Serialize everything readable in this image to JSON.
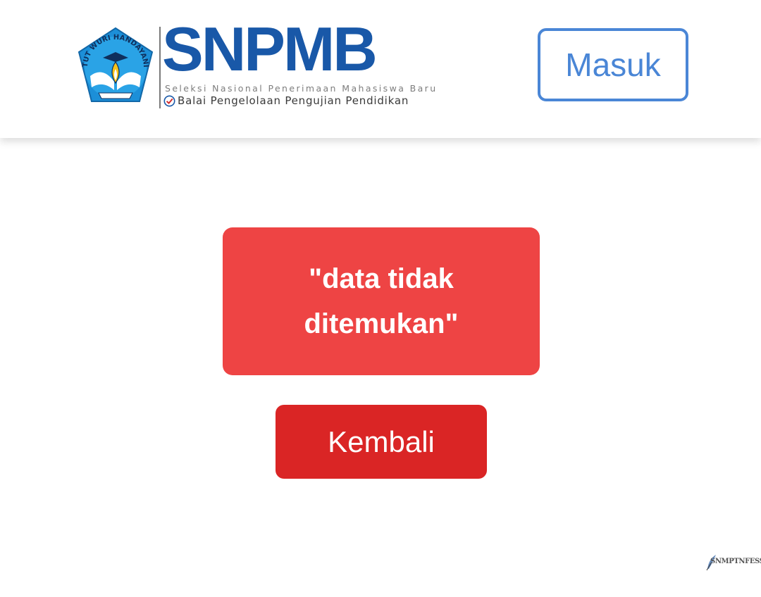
{
  "header": {
    "logo": {
      "emblem_text": "TUT WURI HANDAYANI",
      "wordmark": "SNPMB",
      "tagline": "Seleksi Nasional Penerimaan Mahasiswa Baru",
      "subtitle": "Balai Pengelolaan Pengujian Pendidikan"
    },
    "login_label": "Masuk"
  },
  "main": {
    "message": "\"data tidak ditemukan\"",
    "back_label": "Kembali"
  },
  "watermark": {
    "text": "SNMPTNFESS"
  },
  "colors": {
    "brand_blue": "#1958a8",
    "login_border": "#4a86d6",
    "alert_bg": "#ee4444",
    "back_button_bg": "#da2525"
  },
  "icons": {
    "emblem": "tut-wuri-handayani-emblem",
    "check": "check-circle-icon"
  }
}
